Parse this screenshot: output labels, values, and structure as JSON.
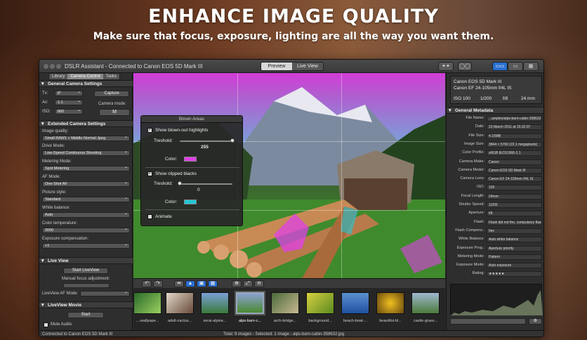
{
  "promo": {
    "headline": "ENHANCE IMAGE QUALITY",
    "subheadline": "Make sure that focus, exposure, lighting are all the way you want them."
  },
  "window": {
    "title": "DSLR Assistant - Connected to Canon EOS 5D Mark III",
    "view_tabs": [
      "Preview",
      "Live View"
    ],
    "active_view": "Preview"
  },
  "left_panel": {
    "tabs": [
      "Library",
      "Camera Control",
      "Tasks"
    ],
    "active_tab": "Camera Control",
    "general": {
      "header": "General Camera Settings",
      "tv_label": "Tv:",
      "tv_value": "8\"",
      "av_label": "Av:",
      "av_value": "1.1",
      "iso_label": "ISO:",
      "iso_value": "800",
      "capture_button": "Capture",
      "camera_mode_label": "Camera mode:",
      "camera_mode_value": "M"
    },
    "extended": {
      "header": "Extended Camera Settings",
      "image_quality_label": "Image quality:",
      "image_quality_value": "Small RAW1 + Middle Normal Jpeg",
      "drive_mode_label": "Drive Mode:",
      "drive_mode_value": "Low-Speed Continuous Shooting",
      "metering_label": "Metering Mode:",
      "metering_value": "Spot Metering",
      "af_mode_label": "AF Mode:",
      "af_mode_value": "One-Shot AF",
      "picture_style_label": "Picture style:",
      "picture_style_value": "Standard",
      "white_balance_label": "White balance:",
      "white_balance_value": "Auto",
      "color_temp_label": "Color temperature:",
      "color_temp_value": "3000",
      "exposure_comp_label": "Exposure compensation:",
      "exposure_comp_value": "+1"
    },
    "live_view": {
      "header": "Live View",
      "start_button": "Start LiveView",
      "manual_focus_label": "Manual focus adjustment:",
      "af_mode_label": "LiveView AF Mode:"
    },
    "movie": {
      "header": "LiveView Movie",
      "start_button": "Start",
      "mute_label": "Mute Audio"
    }
  },
  "blown_panel": {
    "title": "Blown Areas",
    "show_highlights": "Show blown-out highlights",
    "threshold_label": "Treshold:",
    "threshold_high": "255",
    "threshold_high_level": 1.0,
    "color_label": "Color:",
    "highlight_color": "#e040e8",
    "show_blacks": "Show clipped blacks",
    "threshold_low": "0",
    "threshold_low_level": 0.0,
    "blacks_color": "#20c8d8",
    "animate_label": "Animate"
  },
  "filmstrip": {
    "thumbnails": [
      "...-wallpape...",
      "adult-cactus...",
      "serai-alpine...",
      "alps-barn-c...",
      "arch-bridge...",
      "background...",
      "beach-boat-...",
      "beautiful-bl...",
      "castle-grass..."
    ],
    "selected_index": 3
  },
  "right_panel": {
    "camera_model": "Canon EOS 5D Mark III",
    "lens_model": "Canon EF 24-105mm f/4L IS",
    "iso": "ISO 100",
    "shutter": "1/200",
    "aperture": "f/8",
    "focal": "24 mm",
    "metadata_header": "General Metadata",
    "metadata": [
      {
        "key": "File Name:",
        "value": "...amples/alps-barn-cabin-358632.jpg"
      },
      {
        "key": "Date:",
        "value": "23 March 2011 at 15:32:07"
      },
      {
        "key": "File Size:",
        "value": "4.15MB"
      },
      {
        "key": "Image Size:",
        "value": "3844 × 5760 (22.1 megapixels)"
      },
      {
        "key": "Color Profile:",
        "value": "sRGB IEC61966-2.1"
      },
      {
        "key": "Camera Make:",
        "value": "Canon"
      },
      {
        "key": "Camera Model:",
        "value": "Canon EOS 5D Mark III"
      },
      {
        "key": "Camera Lens:",
        "value": "Canon EF 24-105mm f/4L IS"
      },
      {
        "key": "ISO:",
        "value": "100"
      },
      {
        "key": "Focal Length:",
        "value": "24mm"
      },
      {
        "key": "Shutter Speed:",
        "value": "1/200"
      },
      {
        "key": "Aperture:",
        "value": "f/8"
      },
      {
        "key": "Flash:",
        "value": "Flash did not fire, compulsory flash..."
      },
      {
        "key": "Flash Compens.:",
        "value": "0ev"
      },
      {
        "key": "White Balance:",
        "value": "Auto white balance"
      },
      {
        "key": "Exposure Prog.:",
        "value": "Aperture priority"
      },
      {
        "key": "Metering Mode:",
        "value": "Pattern"
      },
      {
        "key": "Exposure Mode:",
        "value": "Auto exposure"
      },
      {
        "key": "Rating:",
        "value": "★★★★★"
      }
    ]
  },
  "status": {
    "connection": "Connected to Canon EOS 5D Mark III",
    "summary": "Total: 9 images - Selected: 1 image - alps-barn-cabin-358632.jpg"
  }
}
